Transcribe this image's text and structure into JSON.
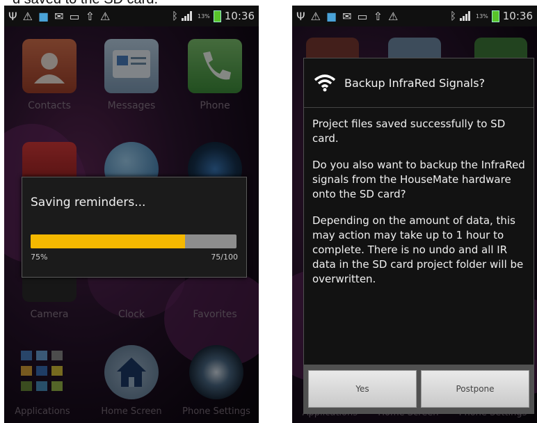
{
  "caption": "d saved to the SD card.",
  "left_screen": {
    "status_bar": {
      "icons": [
        "usb-icon",
        "warning-icon",
        "photo-icon",
        "mail-icon",
        "message-icon",
        "upload-icon",
        "warning-icon"
      ],
      "right_icons": [
        "bluetooth-icon",
        "signal-icon",
        "battery-icon"
      ],
      "battery_pct": "13%",
      "time": "10:36"
    },
    "apps": [
      {
        "label": "Contacts"
      },
      {
        "label": "Messages"
      },
      {
        "label": "Phone"
      },
      {
        "label": "Camera"
      },
      {
        "label": "Clock"
      },
      {
        "label": "Favorites"
      }
    ],
    "dock": [
      {
        "label": "Applications"
      },
      {
        "label": "Home Screen"
      },
      {
        "label": "Phone Settings"
      }
    ],
    "progress_dialog": {
      "title": "Saving reminders...",
      "progress": 0.75,
      "percent_text": "75%",
      "count_text": "75/100"
    }
  },
  "right_screen": {
    "status_bar": {
      "battery_pct": "13%",
      "time": "10:36"
    },
    "dock": [
      {
        "label": "Applications"
      },
      {
        "label": "Home Screen"
      },
      {
        "label": "Phone Settings"
      }
    ],
    "dialog": {
      "title": "Backup InfraRed Signals?",
      "paragraphs": [
        "Project files saved successfully to SD card.",
        "Do you also want to backup the InfraRed signals from the HouseMate hardware onto the SD card?",
        "Depending on the amount of data, this may action may take up to 1 hour to complete. There is no undo and all IR data in the SD card project folder will be overwritten."
      ],
      "yes_label": "Yes",
      "postpone_label": "Postpone"
    }
  },
  "colors": {
    "progress_fill": "#f5b800",
    "progress_track": "#8d8d8d",
    "dialog_bg": "#121212",
    "battery": "#58c32a"
  }
}
